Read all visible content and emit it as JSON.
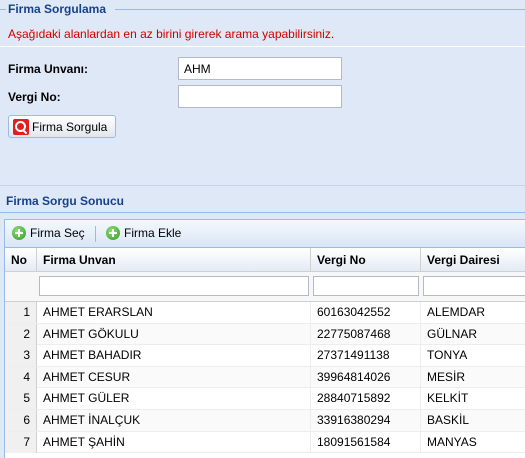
{
  "search_panel": {
    "title": "Firma Sorgulama",
    "info": "Aşağıdaki alanlardan en az birini girerek arama yapabilirsiniz.",
    "company_label": "Firma Unvanı:",
    "company_value": "AHM",
    "tax_label": "Vergi No:",
    "tax_value": "",
    "search_button": "Firma Sorgula",
    "search_button_icon": "search-icon"
  },
  "results_panel": {
    "title": "Firma Sorgu Sonucu",
    "toolbar": {
      "select_label": "Firma Seç",
      "add_label": "Firma Ekle",
      "button_icon": "green-plus-icon"
    },
    "columns": [
      "No",
      "Firma Unvan",
      "Vergi No",
      "Vergi Dairesi"
    ],
    "rows": [
      {
        "no": "1",
        "name": "AHMET ERARSLAN",
        "tax_no": "60163042552",
        "tax_office": "ALEMDAR"
      },
      {
        "no": "2",
        "name": "AHMET GÖKULU",
        "tax_no": "22775087468",
        "tax_office": "GÜLNAR"
      },
      {
        "no": "3",
        "name": "AHMET BAHADIR",
        "tax_no": "27371491138",
        "tax_office": "TONYA"
      },
      {
        "no": "4",
        "name": "AHMET CESUR",
        "tax_no": "39964814026",
        "tax_office": "MESİR"
      },
      {
        "no": "5",
        "name": "AHMET GÜLER",
        "tax_no": "28840715892",
        "tax_office": "KELKİT"
      },
      {
        "no": "6",
        "name": "AHMET İNALÇUK",
        "tax_no": "33916380294",
        "tax_office": "BASKİL"
      },
      {
        "no": "7",
        "name": "AHMET ŞAHİN",
        "tax_no": "18091561584",
        "tax_office": "MANYAS"
      }
    ]
  },
  "colors": {
    "title": "#15428b",
    "info": "#d00000",
    "panel_bg": "#dfe8f6",
    "border": "#99bbe8"
  }
}
